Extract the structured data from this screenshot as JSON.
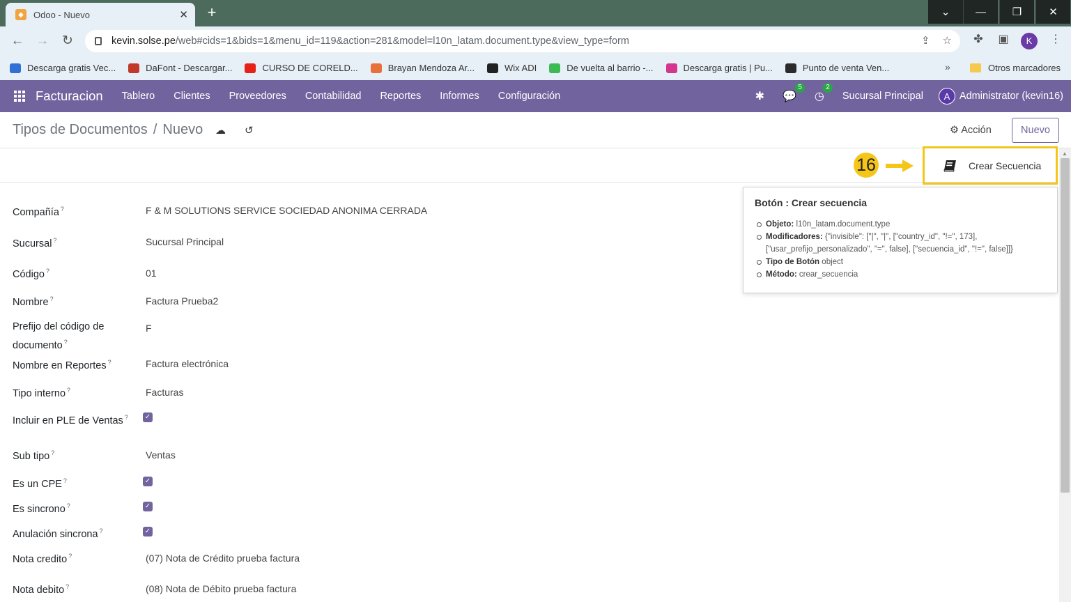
{
  "browser": {
    "tab_title": "Odoo - Nuevo",
    "url_host": "kevin.solse.pe",
    "url_path": "/web#cids=1&bids=1&menu_id=119&action=281&model=l10n_latam.document.type&view_type=form",
    "profile_initial": "K",
    "bookmarks": [
      {
        "label": "Descarga gratis Vec...",
        "color": "#2f6fd6"
      },
      {
        "label": "DaFont - Descargar...",
        "color": "#c0392b"
      },
      {
        "label": "CURSO DE CORELD...",
        "color": "#e62117"
      },
      {
        "label": "Brayan Mendoza Ar...",
        "color": "#e8703a"
      },
      {
        "label": "Wix ADI",
        "color": "#222222"
      },
      {
        "label": "De vuelta al barrio -...",
        "color": "#3cba54"
      },
      {
        "label": "Descarga gratis | Pu...",
        "color": "#d3358f"
      },
      {
        "label": "Punto de venta Ven...",
        "color": "#2b2b2b"
      }
    ],
    "other_bookmarks": "Otros marcadores"
  },
  "navbar": {
    "brand": "Facturacion",
    "menu": [
      "Tablero",
      "Clientes",
      "Proveedores",
      "Contabilidad",
      "Reportes",
      "Informes",
      "Configuración"
    ],
    "messages_count": "5",
    "activities_count": "2",
    "branch": "Sucursal Principal",
    "user_initial": "A",
    "user": "Administrator (kevin16)"
  },
  "control_panel": {
    "breadcrumb_parent": "Tipos de Documentos",
    "breadcrumb_sep": "/",
    "breadcrumb_current": "Nuevo",
    "action_label": "Acción",
    "new_button": "Nuevo"
  },
  "header": {
    "step_number": "16",
    "create_sequence_button": "Crear Secuencia"
  },
  "tooltip": {
    "title": "Botón : Crear secuencia",
    "items": [
      {
        "key": "Objeto:",
        "value": "l10n_latam.document.type"
      },
      {
        "key": "Modificadores:",
        "value": "{\"invisible\": [\"|\", \"|\", [\"country_id\", \"!=\", 173], [\"usar_prefijo_personalizado\", \"=\", false], [\"secuencia_id\", \"!=\", false]]}"
      },
      {
        "key": "Tipo de Botón",
        "value": "object"
      },
      {
        "key": "Método:",
        "value": "crear_secuencia"
      }
    ]
  },
  "form": {
    "fields": [
      {
        "label": "Compañía",
        "value": "F & M SOLUTIONS SERVICE SOCIEDAD ANONIMA CERRADA"
      },
      {
        "label": "Sucursal",
        "value": "Sucursal Principal"
      },
      {
        "label": "Código",
        "value": "01"
      },
      {
        "label": "Nombre",
        "value": "Factura Prueba2"
      },
      {
        "label": "Prefijo del código de documento",
        "value": "F"
      },
      {
        "label": "Nombre en Reportes",
        "value": "Factura electrónica"
      },
      {
        "label": "Tipo interno",
        "value": "Facturas"
      },
      {
        "label": "Incluir en PLE de Ventas",
        "checked": true
      },
      {
        "label": "Sub tipo",
        "value": "Ventas"
      },
      {
        "label": "Es un CPE",
        "checked": true
      },
      {
        "label": "Es sincrono",
        "checked": true
      },
      {
        "label": "Anulación sincrona",
        "checked": true
      },
      {
        "label": "Nota credito",
        "value": "(07) Nota de Crédito prueba factura"
      },
      {
        "label": "Nota debito",
        "value": "(08) Nota de Débito prueba factura"
      }
    ],
    "help_mark": "?"
  },
  "colors": {
    "brand": "#71639e",
    "highlight": "#f5c518",
    "badge": "#28a745"
  }
}
